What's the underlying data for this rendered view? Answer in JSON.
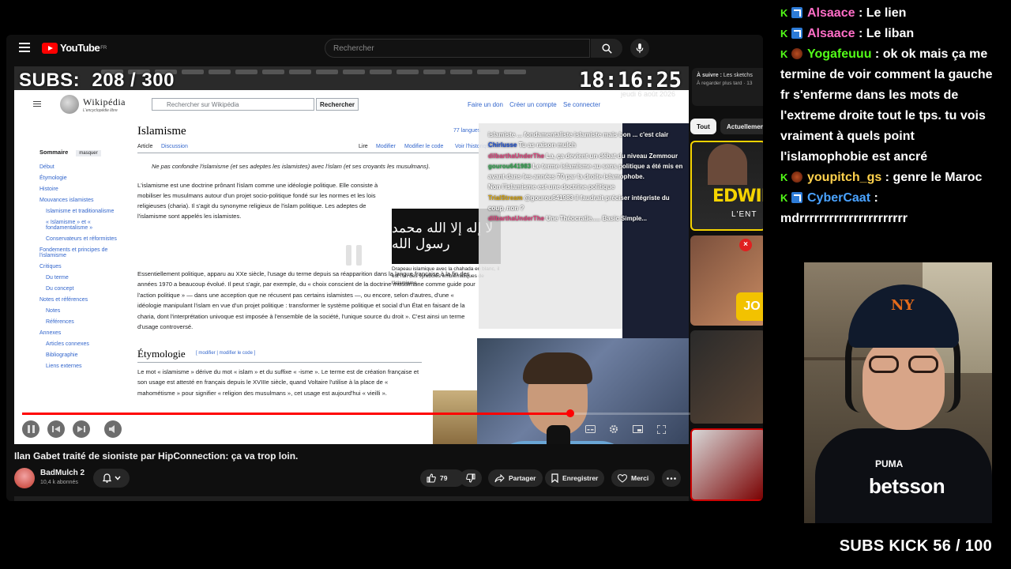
{
  "overlay": {
    "subs_label": "SUBS:",
    "subs_value": "208 / 300",
    "clock": "18:16:25",
    "date": "jeudi 6 août 2026",
    "subs_kick": "SUBS KICK 56 / 100"
  },
  "youtube": {
    "logo": "YouTube",
    "region": "FR",
    "search_placeholder": "Rechercher",
    "video_title": "Ilan Gabet traité de sioniste par HipConnection: ça va trop loin.",
    "channel": "BadMulch 2",
    "channel_subs": "10,4 k abonnés",
    "likes": "79",
    "share": "Partager",
    "save": "Enregistrer",
    "thanks": "Merci",
    "up_next_label": "À suivre :",
    "up_next_title": "Les sketchs",
    "up_next_sub": "À regarder plus tard · 13",
    "chip_all": "Tout",
    "chip_live": "Actuellement i",
    "thumb1_text": "EDWIN",
    "thumb1_sub": "L'ENT",
    "thumb2_text": "JO"
  },
  "wiki": {
    "logo": "Wikipédia",
    "tagline": "L'encyclopédie libre",
    "search_placeholder": "Rechercher sur Wikipédia",
    "search_button": "Rechercher",
    "top_links": [
      "Faire un don",
      "Créer un compte",
      "Se connecter"
    ],
    "toc_title": "Sommaire",
    "toc_hide": "masquer",
    "toc_items": [
      "Début",
      "Étymologie",
      "Histoire",
      "Mouvances islamistes",
      "Islamisme et traditionalisme",
      "« Islamisme » et « fondamentalisme »",
      "Conservateurs et réformistes",
      "Fondements et principes de l'islamisme",
      "Critiques",
      "Du terme",
      "Du concept",
      "Notes et références",
      "Notes",
      "Références",
      "Annexes",
      "Articles connexes",
      "Bibliographie",
      "Liens externes"
    ],
    "title": "Islamisme",
    "langs": "77 langues",
    "tab_article": "Article",
    "tab_discussion": "Discussion",
    "tab_read": "Lire",
    "tab_edit": "Modifier",
    "tab_edit_code": "Modifier le code",
    "tab_history": "Voir l'historique",
    "hatnote": "Ne pas confondre l'islamisme (et ses adeptes les islamistes) avec l'islam (et ses croyants les musulmans).",
    "p1": "L'islamisme est une doctrine prônant l'islam comme une idéologie politique. Elle consiste à mobiliser les musulmans autour d'un projet socio-politique fondé sur les normes et les lois religieuses (charia). Il s'agit du synonyme religieux de l'islam politique. Les adeptes de l'islamisme sont appelés les islamistes.",
    "p2": "Essentiellement politique, apparu au XXe siècle, l'usage du terme depuis sa réapparition dans la langue française à la fin des années 1970 a beaucoup évolué. Il peut s'agir, par exemple, du « choix conscient de la doctrine musulmane comme guide pour l'action politique » — dans une acception que ne récusent pas certains islamistes —, ou encore, selon d'autres, d'une « idéologie manipulant l'islam en vue d'un projet politique : transformer le système politique et social d'un État en faisant de la charia, dont l'interprétation univoque est imposée à l'ensemble de la société, l'unique source du droit ». C'est ainsi un terme d'usage controversé.",
    "etym_title": "Étymologie",
    "etym_edit": "[ modifier | modifier le code ]",
    "etym_text": "Le mot « islamisme » dérive du mot « islam » et du suffixe « -isme ». Le terme est de création française et son usage est attesté en français depuis le XVIIIe siècle, quand Voltaire l'utilise à la place de « mahométisme » pour signifier « religion des musulmans », cet usage est aujourd'hui « vieilli ».",
    "flag_arabic": "لا إله إلا الله محمد رسول الله",
    "flag_caption": "Drapeau islamique avec la chahada en blanc, il est l'un des symboles emblématiques de l'islamisme."
  },
  "inner_chat": [
    {
      "user": "",
      "text": "islamiste ... fondamentaliste islamiste mais bon ... c'est clair"
    },
    {
      "user": "Chirlusse",
      "text": "Tu as raison mulch"
    },
    {
      "user": "dilbarthaUnderThe",
      "text": "La, ça devient un débat du niveau Zemmour"
    },
    {
      "user": "gourou641983",
      "text": "Le terme islamisme au sens politique a été mis en avant dans les années 70 par la droite islamophobe."
    },
    {
      "user": "",
      "text": "Non l'islamisme est une doctrine politique"
    },
    {
      "user": "TrialStream",
      "text": "@gourou641983 il faudrait préciser intégriste du coup, non ?"
    },
    {
      "user": "dilbarthaUnderThe",
      "text": "Une Théocratie..... Basic Simple..."
    }
  ],
  "chat": [
    {
      "user": "Alsaace",
      "color": "#ff6ec7",
      "text": "Le lien",
      "badge": "b"
    },
    {
      "user": "Alsaace",
      "color": "#ff6ec7",
      "text": "Le liban",
      "badge": "b"
    },
    {
      "user": "Yogafeuuu",
      "color": "#53fc18",
      "text": "ok ok mais ça me termine de voir comment la gauche fr s'enferme dans les mots de l'extreme droite tout le tps. tu vois vraiment à quels point l'islamophobie est ancré",
      "badge": "o"
    },
    {
      "user": "youpitch_gs",
      "color": "#ffd24d",
      "text": "genre le Maroc",
      "badge": "o"
    },
    {
      "user": "CyberCaat",
      "color": "#4aa3ff",
      "text": "mdrrrrrrrrrrrrrrrrrrrrrr",
      "badge": "b"
    }
  ],
  "cam": {
    "cap_logo": "NY",
    "brand": "PUMA",
    "sponsor": "betsson"
  }
}
